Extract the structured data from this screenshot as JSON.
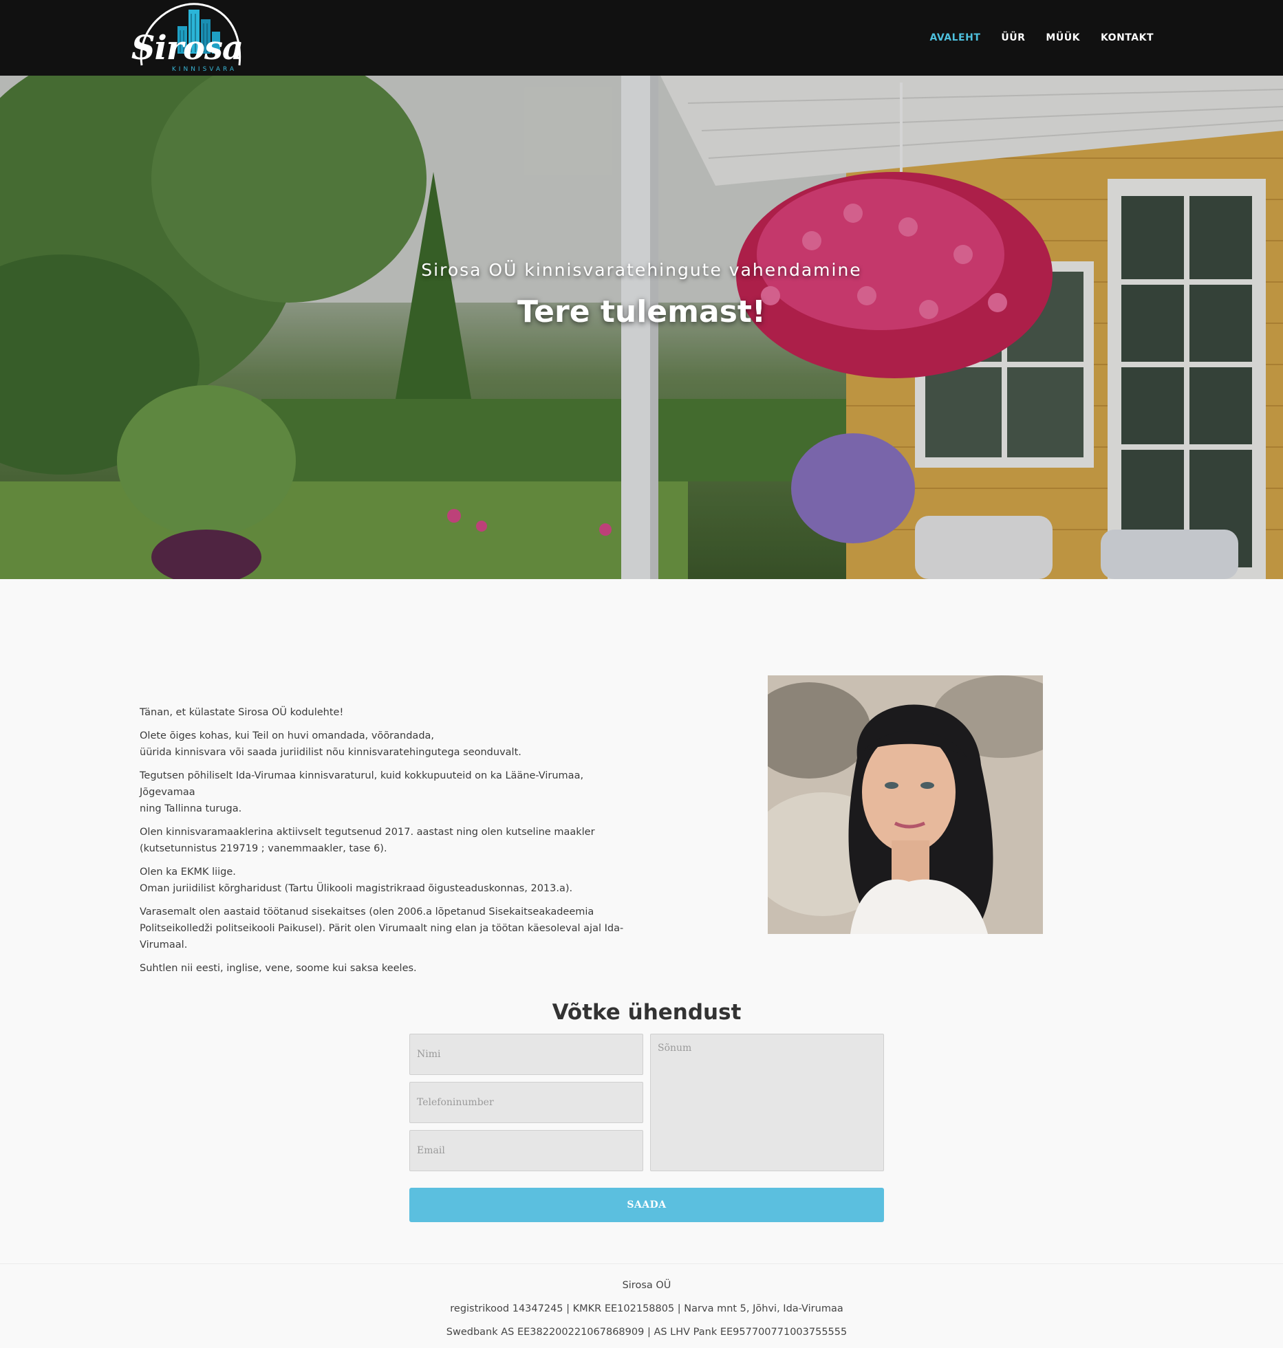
{
  "header": {
    "logo": {
      "name": "Sirosa",
      "tagline": "KINNISVARA"
    },
    "nav": [
      {
        "label": "AVALEHT",
        "active": true
      },
      {
        "label": "ÜÜR",
        "active": false
      },
      {
        "label": "MÜÜK",
        "active": false
      },
      {
        "label": "KONTAKT",
        "active": false
      }
    ]
  },
  "hero": {
    "subtitle": "Sirosa OÜ kinnisvaratehingute vahendamine",
    "title": "Tere tulemast!"
  },
  "about": {
    "paragraphs": [
      [
        "Tänan, et külastate Sirosa OÜ kodulehte!"
      ],
      [
        "Olete õiges kohas, kui Teil on huvi omandada, võõrandada,",
        "üürida kinnisvara või saada juriidilist nõu kinnisvaratehingutega seonduvalt."
      ],
      [
        "Tegutsen põhiliselt Ida-Virumaa kinnisvaraturul, kuid kokkupuuteid on ka Lääne-Virumaa, Jõgevamaa",
        "ning Tallinna turuga."
      ],
      [
        "Olen kinnisvaramaaklerina aktiivselt tegutsenud 2017. aastast ning olen kutseline maakler",
        "(kutsetunnistus 219719 ; vanemmaakler, tase 6)."
      ],
      [
        "Olen ka EKMK liige.",
        "Oman juriidilist kõrgharidust (Tartu Ülikooli magistrikraad õigusteaduskonnas, 2013.a)."
      ],
      [
        "Varasemalt olen aastaid töötanud sisekaitses (olen 2006.a lõpetanud Sisekaitseakadeemia",
        "Politseikolledži politseikooli Paikusel). Pärit olen Virumaalt ning elan ja töötan käesoleval ajal Ida-",
        "Virumaal."
      ],
      [
        "Suhtlen nii eesti, inglise, vene, soome kui saksa keeles."
      ]
    ]
  },
  "contact": {
    "title": "Võtke ühendust",
    "name_placeholder": "Nimi",
    "phone_placeholder": "Telefoninumber",
    "email_placeholder": "Email",
    "message_placeholder": "Sõnum",
    "submit_label": "SAADA"
  },
  "footer": {
    "company": "Sirosa OÜ",
    "registry": "registrikood 14347245 | KMKR EE102158805 | Narva mnt 5, Jõhvi, Ida-Virumaa",
    "banks": "Swedbank AS EE382200221067868909 | AS LHV Pank EE957700771003755555"
  },
  "colors": {
    "header_bg": "#111111",
    "accent": "#4ec0dd",
    "button": "#5bbfdf",
    "page_bg": "#f9f9f9"
  },
  "icons": [
    "logo-buildings-icon"
  ]
}
